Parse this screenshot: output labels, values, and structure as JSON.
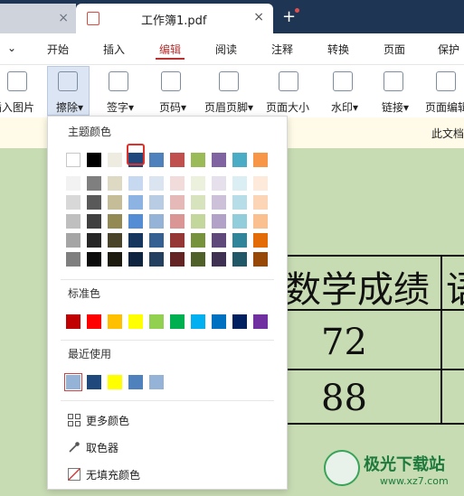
{
  "tabs": {
    "inactive_close": "×",
    "active_title": "工作簿1.pdf",
    "active_close": "×",
    "add": "+"
  },
  "menubar": {
    "arrow": "⌄",
    "items": [
      "开始",
      "插入",
      "编辑",
      "阅读",
      "注释",
      "转换",
      "页面",
      "保护"
    ],
    "active": "编辑"
  },
  "toolbar": {
    "items": [
      "插入图片",
      "擦除▾",
      "签字▾",
      "页码▾",
      "页眉页脚▾",
      "页面大小",
      "水印▾",
      "链接▾",
      "页面编辑"
    ]
  },
  "notice": {
    "text": "此文档"
  },
  "document": {
    "header": "数学成绩",
    "header_right": "语",
    "value1": "72",
    "value2": "88"
  },
  "colors": {
    "theme_title": "主题颜色",
    "standard_title": "标准色",
    "recent_title": "最近使用",
    "theme_top": [
      "#ffffff",
      "#000000",
      "#eeece1",
      "#1f497d",
      "#4f81bd",
      "#c0504d",
      "#9bbb59",
      "#8064a2",
      "#4bacc6",
      "#f79646"
    ],
    "theme_shades": [
      [
        "#f2f2f2",
        "#7f7f7f",
        "#ddd9c3",
        "#c6d9f0",
        "#dbe5f1",
        "#f2dcdb",
        "#ebf1dd",
        "#e5e0ec",
        "#dbeef3",
        "#fdeada"
      ],
      [
        "#d8d8d8",
        "#595959",
        "#c4bd97",
        "#8db3e2",
        "#b8cce4",
        "#e5b9b7",
        "#d7e3bc",
        "#ccc1d9",
        "#b7dde8",
        "#fbd5b5"
      ],
      [
        "#bfbfbf",
        "#3f3f3f",
        "#938953",
        "#548dd4",
        "#95b3d7",
        "#d99694",
        "#c3d69b",
        "#b2a2c7",
        "#92cddc",
        "#fac08f"
      ],
      [
        "#a5a5a5",
        "#262626",
        "#494429",
        "#17365d",
        "#366092",
        "#953734",
        "#76923c",
        "#5f497a",
        "#31859b",
        "#e36c09"
      ],
      [
        "#7f7f7f",
        "#0c0c0c",
        "#1d1b10",
        "#0f243e",
        "#244061",
        "#632423",
        "#4f6128",
        "#3f3151",
        "#205867",
        "#974806"
      ]
    ],
    "standard": [
      "#c00000",
      "#ff0000",
      "#ffc000",
      "#ffff00",
      "#92d050",
      "#00b050",
      "#00b0f0",
      "#0070c0",
      "#002060",
      "#7030a0"
    ],
    "recent": [
      "#95b3d7",
      "#1f497d",
      "#ffff00",
      "#4f81bd",
      "#95b3d7"
    ],
    "selected_index": 3
  },
  "actions": {
    "more_colors": "更多颜色",
    "eyedropper": "取色器",
    "no_fill": "无填充颜色"
  },
  "watermark": {
    "name": "极光下载站",
    "url": "www.xz7.com"
  }
}
